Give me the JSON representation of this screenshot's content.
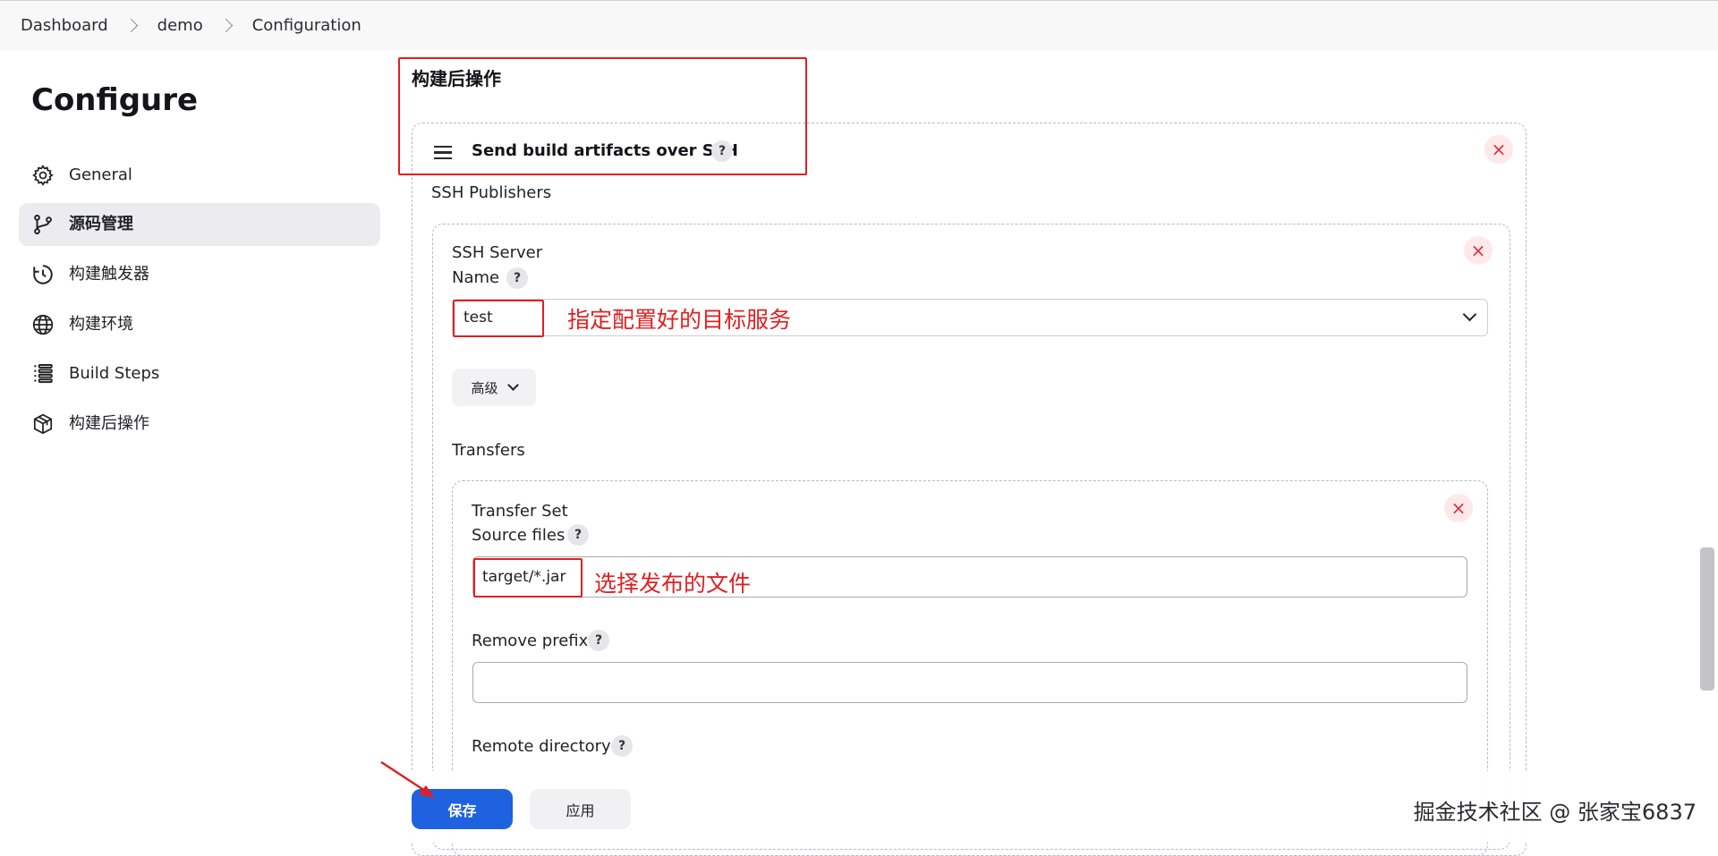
{
  "breadcrumb": [
    "Dashboard",
    "demo",
    "Configuration"
  ],
  "page_title": "Configure",
  "sidebar": {
    "items": [
      {
        "label": "General",
        "icon": "gear-icon"
      },
      {
        "label": "源码管理",
        "icon": "branch-icon",
        "active": true
      },
      {
        "label": "构建触发器",
        "icon": "clock-icon"
      },
      {
        "label": "构建环境",
        "icon": "globe-icon"
      },
      {
        "label": "Build Steps",
        "icon": "list-icon"
      },
      {
        "label": "构建后操作",
        "icon": "cube-icon"
      }
    ]
  },
  "main": {
    "section_title": "构建后操作",
    "step": {
      "title": "Send build artifacts over SSH",
      "help": "?",
      "close": "×",
      "publishers_label": "SSH Publishers",
      "server": {
        "title": "SSH Server",
        "name_label": "Name",
        "name_value": "test",
        "advanced_label": "高级"
      },
      "transfers_label": "Transfers",
      "transfer_set": {
        "title": "Transfer Set",
        "source_files_label": "Source files",
        "source_files_value": "target/*.jar",
        "remove_prefix_label": "Remove prefix",
        "remove_prefix_value": "",
        "remote_directory_label": "Remote directory"
      }
    }
  },
  "annotations": {
    "server": "指定配置好的目标服务",
    "source": "选择发布的文件"
  },
  "buttons": {
    "save": "保存",
    "apply": "应用"
  },
  "credit": "掘金技术社区 @ 张家宝6837",
  "colors": {
    "accent": "#1f62e0",
    "highlight": "#e02020",
    "close": "#d9303f"
  }
}
